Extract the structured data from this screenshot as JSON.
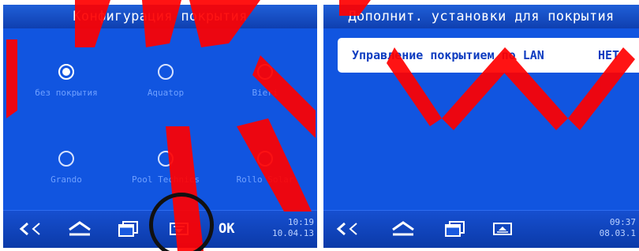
{
  "left_screen": {
    "title": "Конфигурация покрытия",
    "options": [
      {
        "label": "без покрытия",
        "selected": true
      },
      {
        "label": "Aquatop",
        "selected": false
      },
      {
        "label": "Bieri",
        "selected": false
      },
      {
        "label": "Grando",
        "selected": false
      },
      {
        "label": "Pool Technics",
        "selected": false
      },
      {
        "label": "Rollo Solar",
        "selected": false
      }
    ],
    "ok_label": "OK",
    "time": "10:19",
    "date": "10.04.13"
  },
  "right_screen": {
    "title": "Дополнит. установки для покрытия",
    "setting": {
      "label": "Управление покрытием по LAN",
      "value": "НЕТ"
    },
    "time": "09:37",
    "date": "08.03.1"
  },
  "icons": {
    "back": "back-arrow-icon",
    "home": "home-icon",
    "windows": "windows-icon",
    "menu_down": "menu-down-icon",
    "menu_up": "menu-up-icon"
  },
  "colors": {
    "screen_blue": "#1155e0",
    "label_blue": "#6fa0ff",
    "watermark_red": "#ff0000"
  }
}
